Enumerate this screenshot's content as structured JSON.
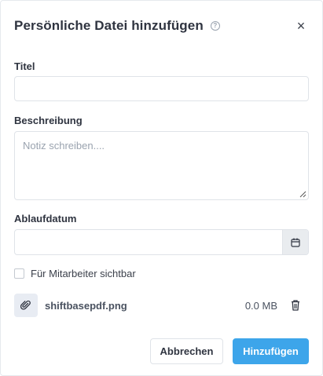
{
  "modal": {
    "title": "Persönliche Datei hinzufügen",
    "help_glyph": "?",
    "close_glyph": "×"
  },
  "fields": {
    "title_label": "Titel",
    "title_value": "",
    "description_label": "Beschreibung",
    "description_placeholder": "Notiz schreiben....",
    "expiry_label": "Ablaufdatum",
    "expiry_value": ""
  },
  "visibility": {
    "label": "Für Mitarbeiter sichtbar",
    "checked": false
  },
  "attachment": {
    "file_name": "shiftbasepdf.png",
    "file_size": "0.0 MB",
    "icon": "paperclip-icon"
  },
  "actions": {
    "cancel_label": "Abbrechen",
    "add_label": "Hinzufügen"
  },
  "colors": {
    "primary": "#3da5ea",
    "border": "#dfe3e8",
    "text": "#2f3440"
  }
}
